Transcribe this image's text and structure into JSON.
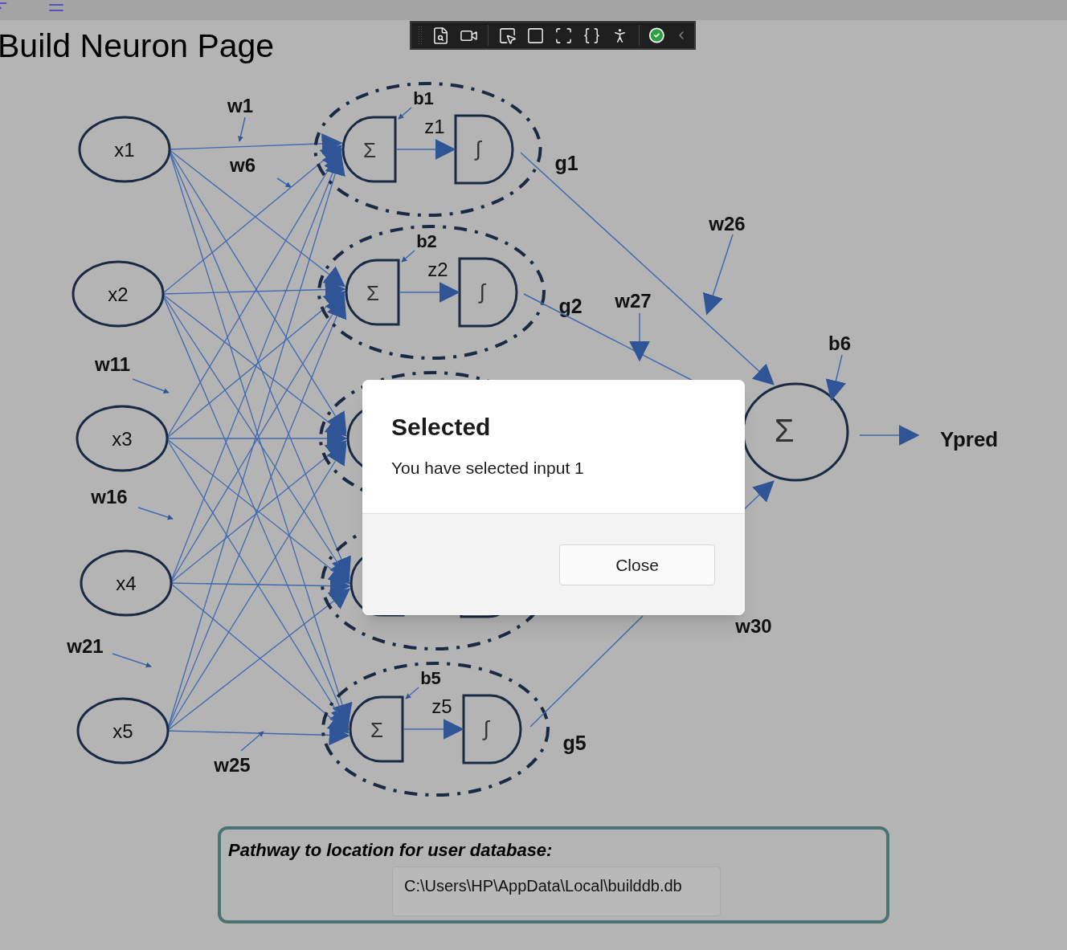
{
  "page": {
    "title": "Build Neuron Page"
  },
  "diagram": {
    "inputs": [
      {
        "label": "x1"
      },
      {
        "label": "x2"
      },
      {
        "label": "x3"
      },
      {
        "label": "x4"
      },
      {
        "label": "x5"
      }
    ],
    "hidden": [
      {
        "kind": "labeled",
        "bias": "b1",
        "z": "z1",
        "output": "g1",
        "sum_symbol": "Σ",
        "activation_symbol": "∫"
      },
      {
        "kind": "labeled",
        "bias": "b2",
        "z": "z2",
        "output": "g2",
        "sum_symbol": "Σ",
        "activation_symbol": "∫"
      },
      {
        "kind": "partial"
      },
      {
        "kind": "plain"
      },
      {
        "kind": "labeled",
        "bias": "b5",
        "z": "z5",
        "output": "g5",
        "sum_symbol": "Σ",
        "activation_symbol": "∫"
      }
    ],
    "weights": [
      {
        "label": "w1"
      },
      {
        "label": "w6"
      },
      {
        "label": "w11"
      },
      {
        "label": "w16"
      },
      {
        "label": "w21"
      },
      {
        "label": "w25"
      },
      {
        "label": "w26"
      },
      {
        "label": "w27"
      },
      {
        "label": "w30"
      }
    ],
    "output": {
      "sum_symbol": "Σ",
      "bias": "b6",
      "label": "Ypred"
    }
  },
  "dialog": {
    "title": "Selected",
    "message": "You have selected input 1",
    "buttons": [
      "Close"
    ]
  },
  "database": {
    "label": "Pathway to location for user database:",
    "value": "C:\\Users\\HP\\AppData\\Local\\builddb.db"
  }
}
